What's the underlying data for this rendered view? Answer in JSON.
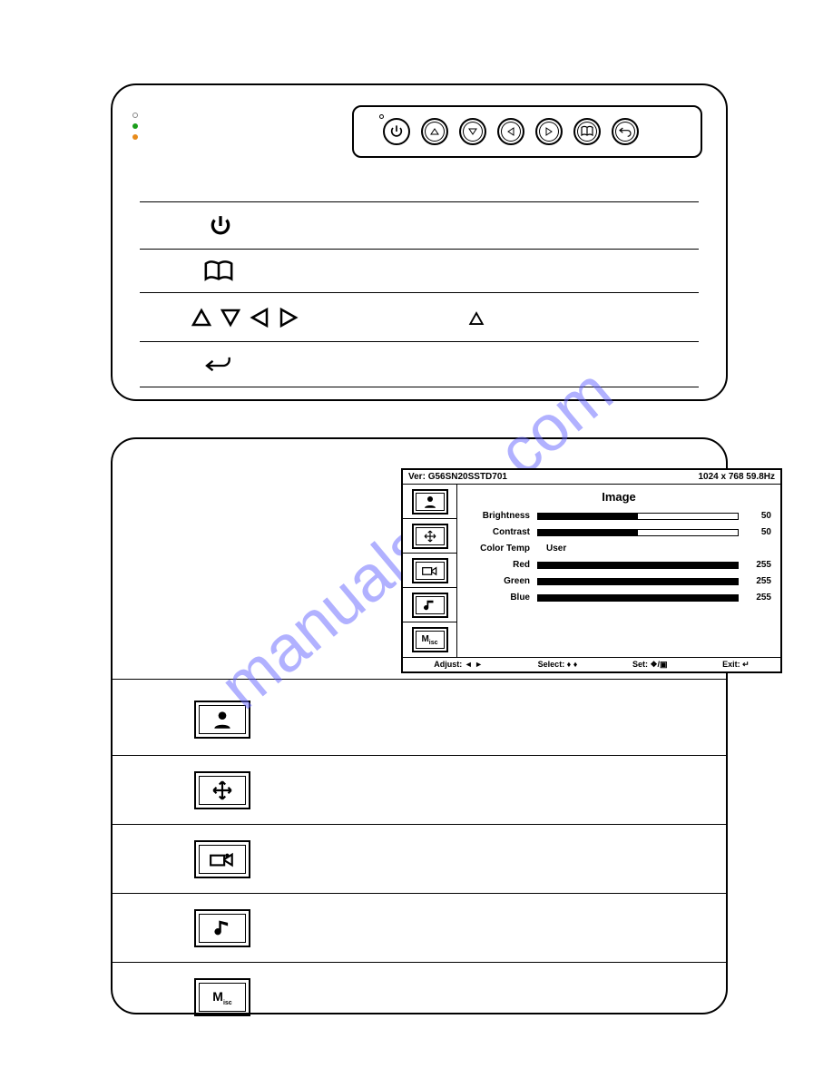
{
  "watermark": "manualslive.com",
  "osd": {
    "version_label": "Ver:",
    "version": "G56SN20SSTD701",
    "resolution": "1024 x 768  59.8Hz",
    "title": "Image",
    "rows": [
      {
        "label": "Brightness",
        "value": "50",
        "pct": 50
      },
      {
        "label": "Contrast",
        "value": "50",
        "pct": 50
      },
      {
        "label": "Color Temp",
        "value": "User",
        "pct": null
      },
      {
        "label": "Red",
        "value": "255",
        "pct": 100
      },
      {
        "label": "Green",
        "value": "255",
        "pct": 100
      },
      {
        "label": "Blue",
        "value": "255",
        "pct": 100
      }
    ],
    "footer": {
      "adjust": "Adjust: ◄ ►",
      "select": "Select: ♦ ♦",
      "set": "Set: ❖/▣",
      "exit": "Exit: ↵"
    }
  },
  "misc_label": "Misc"
}
